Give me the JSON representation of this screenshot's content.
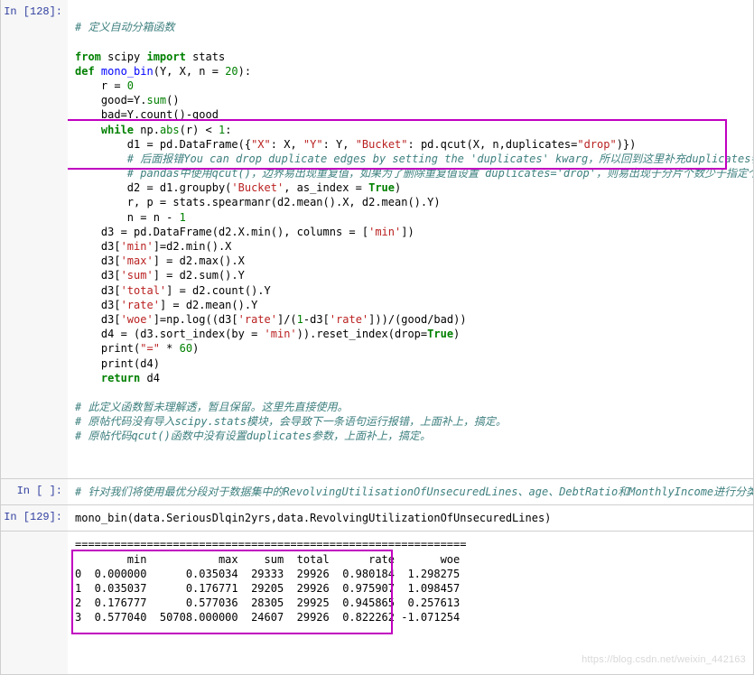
{
  "cells": {
    "c0": {
      "prompt": "In [128]:"
    },
    "c1": {
      "prompt": "In [ ]:"
    },
    "c2": {
      "prompt": "In [129]:"
    }
  },
  "code0": {
    "l0": "# 定义自动分箱函数",
    "l1a": "from",
    "l1b": " scipy ",
    "l1c": "import",
    "l1d": " stats",
    "l2a": "def",
    "l2b": " ",
    "l2c": "mono_bin",
    "l2d": "(Y, X, n = ",
    "l2e": "20",
    "l2f": "):",
    "l3": "    r = ",
    "l3n": "0",
    "l4a": "    good=Y.",
    "l4b": "sum",
    "l4c": "()",
    "l5": "    bad=Y.count()-good",
    "l6a": "    ",
    "l6b": "while",
    "l6c": " np.",
    "l6d": "abs",
    "l6e": "(r) < ",
    "l6f": "1",
    "l6g": ":",
    "l7a": "        d1 = pd.DataFrame({",
    "l7b": "\"X\"",
    "l7c": ": X, ",
    "l7d": "\"Y\"",
    "l7e": ": Y, ",
    "l7f": "\"Bucket\"",
    "l7g": ": pd.qcut(X, n,duplicates=",
    "l7h": "\"drop\"",
    "l7i": ")})",
    "l8": "        # 后面报错You can drop duplicate edges by setting the 'duplicates' kwarg，所以回到这里补充duplicates参数",
    "l9": "        # pandas中使用qcut()，边界易出现重复值，如果为了删除重复值设置 duplicates='drop'，则易出现于分片个数少于指定个数的问题",
    "l10a": "        d2 = d1.groupby(",
    "l10b": "'Bucket'",
    "l10c": ", as_index = ",
    "l10d": "True",
    "l10e": ")",
    "l11": "        r, p = stats.spearmanr(d2.mean().X, d2.mean().Y)",
    "l12a": "        n = n - ",
    "l12b": "1",
    "l13a": "    d3 = pd.DataFrame(d2.X.min(), columns = [",
    "l13b": "'min'",
    "l13c": "])",
    "l14a": "    d3[",
    "l14b": "'min'",
    "l14c": "]=d2.min().X",
    "l15a": "    d3[",
    "l15b": "'max'",
    "l15c": "] = d2.max().X",
    "l16a": "    d3[",
    "l16b": "'sum'",
    "l16c": "] = d2.sum().Y",
    "l17a": "    d3[",
    "l17b": "'total'",
    "l17c": "] = d2.count().Y",
    "l18a": "    d3[",
    "l18b": "'rate'",
    "l18c": "] = d2.mean().Y",
    "l19a": "    d3[",
    "l19b": "'woe'",
    "l19c": "]=np.log((d3[",
    "l19d": "'rate'",
    "l19e": "]/(",
    "l19f": "1",
    "l19g": "-d3[",
    "l19h": "'rate'",
    "l19i": "]))/(good/bad))",
    "l20a": "    d4 = (d3.sort_index(by = ",
    "l20b": "'min'",
    "l20c": ")).reset_index(drop=",
    "l20d": "True",
    "l20e": ")",
    "l21a": "    print(",
    "l21b": "\"=\"",
    "l21c": " * ",
    "l21d": "60",
    "l21e": ")",
    "l22": "    print(d4)",
    "l23a": "    ",
    "l23b": "return",
    "l23c": " d4",
    "l24": "# 此定义函数暂未理解透，暂且保留。这里先直接使用。",
    "l25": "# 原帖代码没有导入scipy.stats模块，会导致下一条语句运行报错，上面补上，搞定。",
    "l26": "# 原帖代码qcut()函数中没有设置duplicates参数，上面补上，搞定。"
  },
  "code1": "# 针对我们将使用最优分段对于数据集中的RevolvingUtilisationOfUnsecuredLines、age、DebtRatio和MonthlyIncome进行分类。",
  "code2": "mono_bin(data.SeriousDlqin2yrs,data.RevolvingUtilizationOfUnsecuredLines)",
  "output_divider": "============================================================",
  "chart_data": {
    "type": "table",
    "columns": [
      "",
      "min",
      "max",
      "sum",
      "total",
      "rate",
      "woe"
    ],
    "rows": [
      [
        0,
        0.0,
        0.035034,
        29333,
        29926,
        0.980184,
        1.298275
      ],
      [
        1,
        0.035037,
        0.176771,
        29205,
        29926,
        0.975907,
        1.098457
      ],
      [
        2,
        0.176777,
        0.577036,
        28305,
        29925,
        0.945865,
        0.257613
      ],
      [
        3,
        0.57704,
        50708.0,
        24607,
        29926,
        0.822262,
        -1.071254
      ]
    ]
  },
  "output_text": "        min           max    sum  total      rate       woe\n0  0.000000      0.035034  29333  29926  0.980184  1.298275\n1  0.035037      0.176771  29205  29926  0.975907  1.098457\n2  0.176777      0.577036  28305  29925  0.945865  0.257613\n3  0.577040  50708.000000  24607  29926  0.822262 -1.071254",
  "watermark": "https://blog.csdn.net/weixin_442163"
}
